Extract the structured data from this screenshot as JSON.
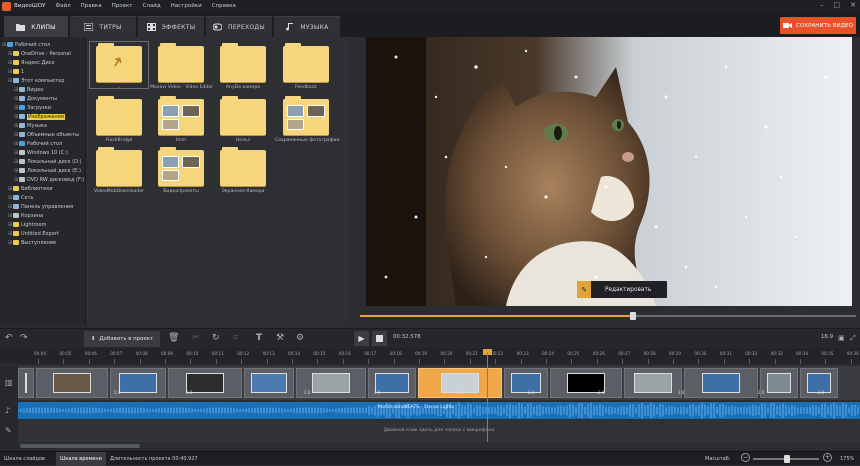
{
  "app": {
    "title": "ВидеоШОУ"
  },
  "menu": [
    "Файл",
    "Правка",
    "Проект",
    "Слайд",
    "Настройки",
    "Справка"
  ],
  "tabs": [
    {
      "label": "КЛИПЫ",
      "icon": "folder-icon"
    },
    {
      "label": "ТИТРЫ",
      "icon": "titles-icon"
    },
    {
      "label": "ЭФФЕКТЫ",
      "icon": "effects-icon"
    },
    {
      "label": "ПЕРЕХОДЫ",
      "icon": "transitions-icon"
    },
    {
      "label": "МУЗЫКА",
      "icon": "music-icon"
    }
  ],
  "save_button": "СОХРАНИТЬ ВИДЕО",
  "tree": [
    {
      "label": "Рабочий стол",
      "level": 0,
      "color": "#4aa3df"
    },
    {
      "label": "OneDrive - Personal",
      "level": 1,
      "color": "#f2c94c"
    },
    {
      "label": "Яндекс.Диск",
      "level": 1,
      "color": "#f2c94c"
    },
    {
      "label": "1",
      "level": 1,
      "color": "#f2c94c"
    },
    {
      "label": "Этот компьютер",
      "level": 1,
      "color": "#8fb6d8"
    },
    {
      "label": "Видео",
      "level": 2,
      "color": "#8fb6d8"
    },
    {
      "label": "Документы",
      "level": 2,
      "color": "#8fb6d8"
    },
    {
      "label": "Загрузки",
      "level": 2,
      "color": "#4aa3df"
    },
    {
      "label": "Изображения",
      "level": 2,
      "color": "#8fb6d8",
      "selected": true
    },
    {
      "label": "Музыка",
      "level": 2,
      "color": "#8fb6d8"
    },
    {
      "label": "Объемные объекты",
      "level": 2,
      "color": "#8fb6d8"
    },
    {
      "label": "Рабочий стол",
      "level": 2,
      "color": "#4aa3df"
    },
    {
      "label": "Windows 10 (C:)",
      "level": 2,
      "color": "#bfc4ca"
    },
    {
      "label": "Локальный диск (D:)",
      "level": 2,
      "color": "#bfc4ca"
    },
    {
      "label": "Локальный диск (E:)",
      "level": 2,
      "color": "#bfc4ca"
    },
    {
      "label": "DVD RW дисковод (F:)",
      "level": 2,
      "color": "#bfc4ca"
    },
    {
      "label": "Библиотеки",
      "level": 1,
      "color": "#f2c94c"
    },
    {
      "label": "Сеть",
      "level": 1,
      "color": "#8fb6d8"
    },
    {
      "label": "Панель управления",
      "level": 1,
      "color": "#8fb6d8"
    },
    {
      "label": "Корзина",
      "level": 1,
      "color": "#bfc4ca"
    },
    {
      "label": "Lightroom",
      "level": 1,
      "color": "#f2c94c"
    },
    {
      "label": "Untitled Export",
      "level": 1,
      "color": "#f2c94c"
    },
    {
      "label": "Выступление",
      "level": 1,
      "color": "#f2c94c"
    }
  ],
  "files": [
    {
      "label": "..",
      "kind": "up"
    },
    {
      "label": "Movavi Video - Video Editor",
      "kind": "folder"
    },
    {
      "label": "AnyDo камера",
      "kind": "folder"
    },
    {
      "label": "Feedback",
      "kind": "folder"
    },
    {
      "label": "FlashBridge",
      "kind": "folder"
    },
    {
      "label": "Imm",
      "kind": "folder-thumbs"
    },
    {
      "label": "Нельз",
      "kind": "folder"
    },
    {
      "label": "Сохраненные фотографии",
      "kind": "folder-thumbs"
    },
    {
      "label": "VideoMobDownloader",
      "kind": "folder"
    },
    {
      "label": "Видеопроекты",
      "kind": "folder-thumbs"
    },
    {
      "label": "Экранная Камера",
      "kind": "folder"
    }
  ],
  "preview": {
    "edit_button": "Редактировать",
    "progress": 0.55
  },
  "toolbar": {
    "add_button": "Добавить в проект",
    "time": "00:32.578",
    "ratio": "16:9"
  },
  "ruler": [
    "00:04",
    "00:05",
    "00:06",
    "00:07",
    "00:08",
    "00:09",
    "00:10",
    "00:11",
    "00:12",
    "00:13",
    "00:14",
    "00:15",
    "00:16",
    "00:17",
    "00:18",
    "00:19",
    "00:20",
    "00:21",
    "00:22",
    "00:23",
    "00:24",
    "00:25",
    "00:26",
    "00:27",
    "00:28",
    "00:29",
    "00:30",
    "00:31",
    "00:32",
    "00:33",
    "00:34",
    "00:35",
    "00:36"
  ],
  "clips": [
    {
      "num": "",
      "w": 18,
      "color": "#5b5e64"
    },
    {
      "num": "",
      "w": 74,
      "color": "#5b5e64"
    },
    {
      "num": "",
      "w": 58,
      "color": "#5b5e64"
    },
    {
      "num": "",
      "w": 76,
      "color": "#5b5e64"
    },
    {
      "num": "",
      "w": 52,
      "color": "#5b5e64"
    },
    {
      "num": "",
      "w": 72,
      "color": "#5b5e64"
    },
    {
      "num": "",
      "w": 50,
      "color": "#5b5e64"
    },
    {
      "num": "",
      "w": 86,
      "color": "#f0a74a",
      "selected": true
    },
    {
      "num": "",
      "w": 46,
      "color": "#5b5e64"
    },
    {
      "num": "",
      "w": 74,
      "color": "#5b5e64"
    },
    {
      "num": "",
      "w": 60,
      "color": "#5b5e64"
    },
    {
      "num": "",
      "w": 76,
      "color": "#5b5e64"
    },
    {
      "num": "",
      "w": 40,
      "color": "#5b5e64"
    },
    {
      "num": "",
      "w": 40,
      "color": "#5b5e64"
    }
  ],
  "clip_numbers": [
    "2.0",
    "2.0",
    "2.0",
    "2.0",
    "2.0",
    "2.0",
    "2.0",
    "2.0",
    "2.0",
    "2.0"
  ],
  "audio": {
    "label": "MotionsandBEATS - Stereo Lights"
  },
  "mic": {
    "label": "Двойной клик здесь для записи с микрофона"
  },
  "status": {
    "tab_slides": "Шкала слайдов",
    "tab_timeline": "Шкала времени",
    "duration": "Длительность проекта 00:40.927",
    "zoom_label": "Масштаб:",
    "zoom_value": "175%"
  }
}
